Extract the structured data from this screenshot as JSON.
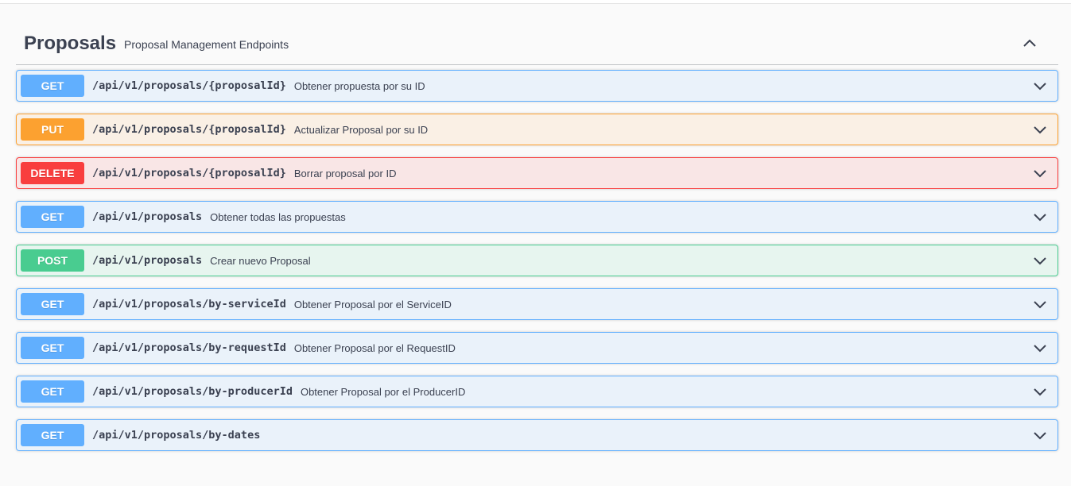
{
  "section": {
    "title": "Proposals",
    "description": "Proposal Management Endpoints",
    "collapse_icon": "chevron-up-icon"
  },
  "operations": [
    {
      "method": "GET",
      "path": "/api/v1/proposals/{proposalId}",
      "summary": "Obtener propuesta por su ID"
    },
    {
      "method": "PUT",
      "path": "/api/v1/proposals/{proposalId}",
      "summary": "Actualizar Proposal por su ID"
    },
    {
      "method": "DELETE",
      "path": "/api/v1/proposals/{proposalId}",
      "summary": "Borrar proposal por ID"
    },
    {
      "method": "GET",
      "path": "/api/v1/proposals",
      "summary": "Obtener todas las propuestas"
    },
    {
      "method": "POST",
      "path": "/api/v1/proposals",
      "summary": "Crear nuevo Proposal"
    },
    {
      "method": "GET",
      "path": "/api/v1/proposals/by-serviceId",
      "summary": "Obtener Proposal por el ServiceID"
    },
    {
      "method": "GET",
      "path": "/api/v1/proposals/by-requestId",
      "summary": "Obtener Proposal por el RequestID"
    },
    {
      "method": "GET",
      "path": "/api/v1/proposals/by-producerId",
      "summary": "Obtener Proposal por el ProducerID"
    },
    {
      "method": "GET",
      "path": "/api/v1/proposals/by-dates",
      "summary": ""
    }
  ],
  "colors": {
    "GET": "#61affe",
    "PUT": "#fca130",
    "DELETE": "#f93e3e",
    "POST": "#49cc90"
  },
  "icons": {
    "expand": "chevron-down-icon"
  }
}
